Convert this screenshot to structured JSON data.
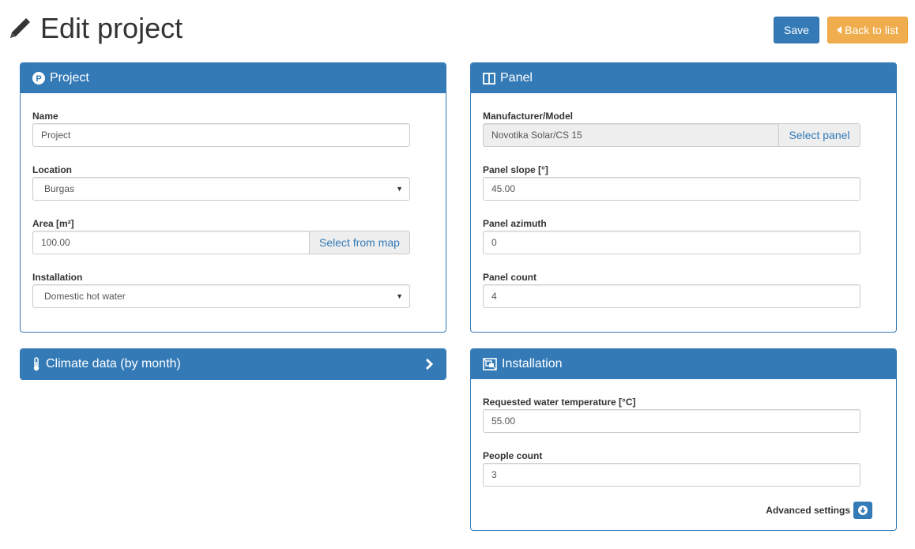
{
  "header": {
    "title": "Edit project",
    "save_label": "Save",
    "back_label": "Back to list"
  },
  "project_panel": {
    "title": "Project",
    "name_label": "Name",
    "name_value": "Project",
    "location_label": "Location",
    "location_value": "Burgas",
    "area_label": "Area [m²]",
    "area_value": "100.00",
    "area_button": "Select from map",
    "installation_label": "Installation",
    "installation_value": "Domestic hot water"
  },
  "climate_panel": {
    "title": "Climate data (by month)"
  },
  "panel_panel": {
    "title": "Panel",
    "model_label": "Manufacturer/Model",
    "model_value": "Novotika Solar/CS 15",
    "model_button": "Select panel",
    "slope_label": "Panel slope [°]",
    "slope_value": "45.00",
    "azimuth_label": "Panel azimuth",
    "azimuth_value": "0",
    "count_label": "Panel count",
    "count_value": "4"
  },
  "installation_panel": {
    "title": "Installation",
    "temp_label": "Requested water temperature [°C]",
    "temp_value": "55.00",
    "people_label": "People count",
    "people_value": "3",
    "advanced_label": "Advanced settings"
  },
  "colors": {
    "primary": "#337ab7",
    "warning": "#f0ad4e"
  },
  "icons": [
    "pencil-icon",
    "parking-icon",
    "thermometer-icon",
    "chevron-right-icon",
    "columns-icon",
    "installation-icon",
    "caret-left-icon",
    "arrow-down-icon"
  ]
}
